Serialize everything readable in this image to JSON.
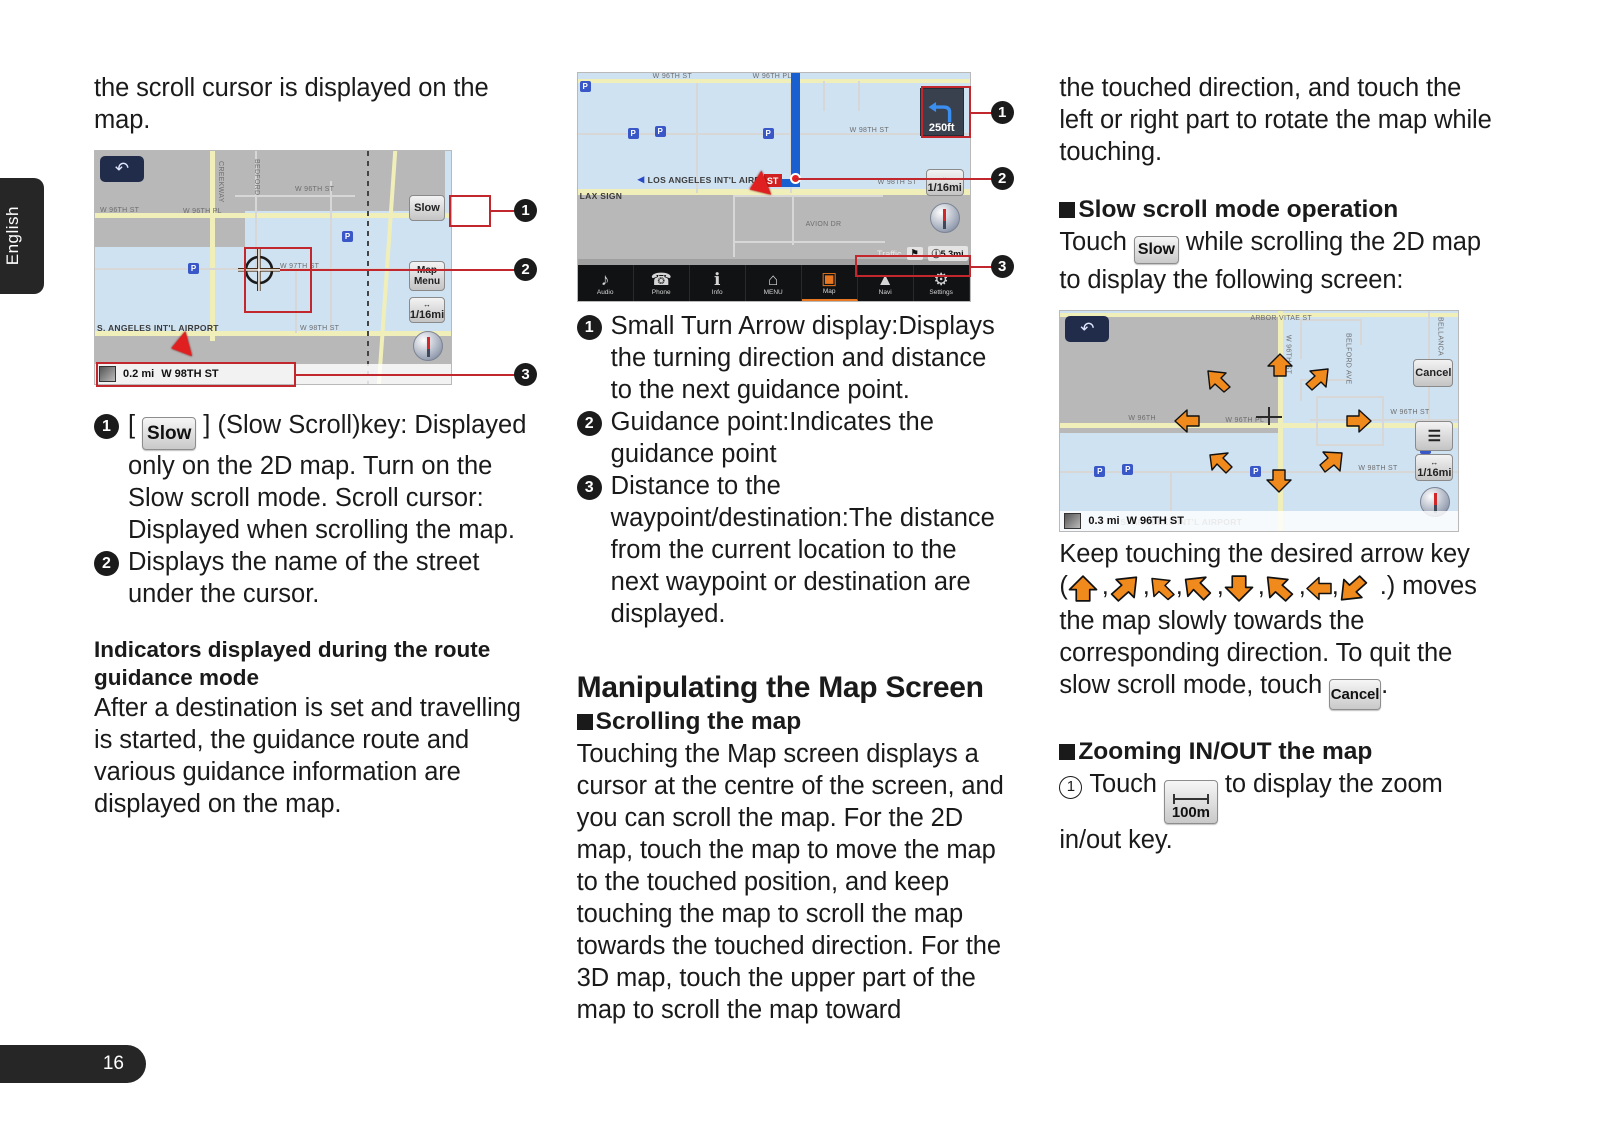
{
  "page": {
    "language_tab": "English",
    "page_number": "16"
  },
  "left_column": {
    "intro_text": "the scroll cursor is displayed on the map.",
    "figure": {
      "name": "2D map with scroll cursor",
      "back_icon": "back-arrow-icon",
      "slow_key": "Slow",
      "map_menu_key": "Map Menu",
      "scale_key": "1/16mi",
      "street_distance": "0.2 mi",
      "street_name": "W 98TH ST",
      "map_labels": [
        "BEDFORD",
        "CREEKWAY",
        "W 96TH ST",
        "W 96TH PL",
        "W 96TH ST",
        "W 97TH ST",
        "LOS ANGELES INT'L AIRPORT",
        "W 98TH ST"
      ],
      "callouts": [
        "1",
        "2",
        "3"
      ]
    },
    "items": [
      {
        "num": "1",
        "pre": "[",
        "key": "Slow",
        "post": "] (Slow Scroll)key: Displayed only on the 2D map. Turn on the Slow scroll mode. Scroll cursor: Displayed when scrolling the map."
      },
      {
        "num": "2",
        "pre": "",
        "key": "",
        "post": "Displays the name of the street under the cursor."
      }
    ],
    "indicators_heading": "Indicators displayed during the route guidance mode",
    "indicators_body": "After a destination is set and travelling is started, the guidance route and various guidance information are displayed on the map."
  },
  "middle_column": {
    "figure": {
      "name": "Route guidance map",
      "turn_distance": "250ft",
      "scale_key": "1/16mi",
      "traffic_label": "Traffic",
      "remaining_distance": "5.3mi",
      "map_labels": [
        "W 96TH ST",
        "W 96TH PL",
        "W 98TH ST",
        "LOS ANGELES INT'L AIRPORT",
        "LAX SIGN",
        "AVION DR",
        "W 98TH ST"
      ],
      "toolbar": [
        {
          "icon": "music-note-icon",
          "label": "Audio"
        },
        {
          "icon": "phone-handset-icon",
          "label": "Phone"
        },
        {
          "icon": "info-icon",
          "label": "Info"
        },
        {
          "icon": "home-icon",
          "label": "MENU"
        },
        {
          "icon": "map-split-icon",
          "label": "Map"
        },
        {
          "icon": "navi-arrow-icon",
          "label": "Navi"
        },
        {
          "icon": "gear-icon",
          "label": "Settings"
        }
      ],
      "callouts": [
        "1",
        "2",
        "3"
      ]
    },
    "items": [
      {
        "num": "1",
        "text": "Small Turn Arrow display:Displays the turning direction and distance to the next guidance point."
      },
      {
        "num": "2",
        "text": "Guidance point:Indicates the guidance point"
      },
      {
        "num": "3",
        "text": "Distance to the waypoint/destination:The distance from the current location to the next waypoint or destination are displayed."
      }
    ],
    "section_title": "Manipulating the Map Screen",
    "sub_heading": "Scrolling the map",
    "body": "Touching the Map screen displays a cursor at the centre of the screen, and you can scroll the map. For the 2D map, touch the map to move the map to the touched position, and keep touching the map to scroll the map towards the touched direction. For the 3D map, touch the upper part of the map to scroll the map toward"
  },
  "right_column": {
    "continued_text": "the touched direction, and touch the left or right part to rotate the map while touching.",
    "slow_heading": "Slow scroll mode operation",
    "slow_body_pre": "Touch",
    "slow_key": "Slow",
    "slow_body_post": "while scrolling the 2D map to display the following screen:",
    "figure": {
      "name": "Slow scroll mode map with 8 arrow keys",
      "back_icon": "back-arrow-icon",
      "cancel_key": "Cancel",
      "list_key": "list-icon",
      "scale_key": "1/16mi",
      "street_distance": "0.3 mi",
      "street_name": "W 96TH ST",
      "map_labels": [
        "ARBOR VITAE ST",
        "BELLANCA",
        "BELFORD AVE",
        "W 96TH ST",
        "W 96TH PL",
        "W 96TH ST",
        "W 98TH ST",
        "LOS ANGELES INT'L AIRPORT"
      ],
      "arrow_keys": [
        "up",
        "up-right",
        "right",
        "down-right",
        "down",
        "down-left",
        "left",
        "up-left"
      ]
    },
    "keep_touching_pre": "Keep touching the desired arrow key",
    "keep_touching_open": "(",
    "arrow_glyphs": [
      "up",
      "up-right",
      "right",
      "down-right",
      "down",
      "down-left",
      "left",
      "up-left"
    ],
    "keep_touching_post": ".) moves the map slowly towards the corresponding direction. To quit the slow scroll mode, touch",
    "cancel_key": "Cancel",
    "period": ".",
    "zoom_heading": "Zooming IN/OUT the map",
    "zoom_item_num": "1",
    "zoom_pre": "Touch",
    "zoom_key": "100m",
    "zoom_post": "to display the zoom in/out key."
  },
  "colors": {
    "callout_red": "#c1272d",
    "dark_chip": "#262626",
    "map_water": "#cfe2f2",
    "map_land": "#b8b8b8",
    "route_blue": "#1a5fd0",
    "arrow_orange": "#f08a1d",
    "accent_orange": "#e87722"
  }
}
